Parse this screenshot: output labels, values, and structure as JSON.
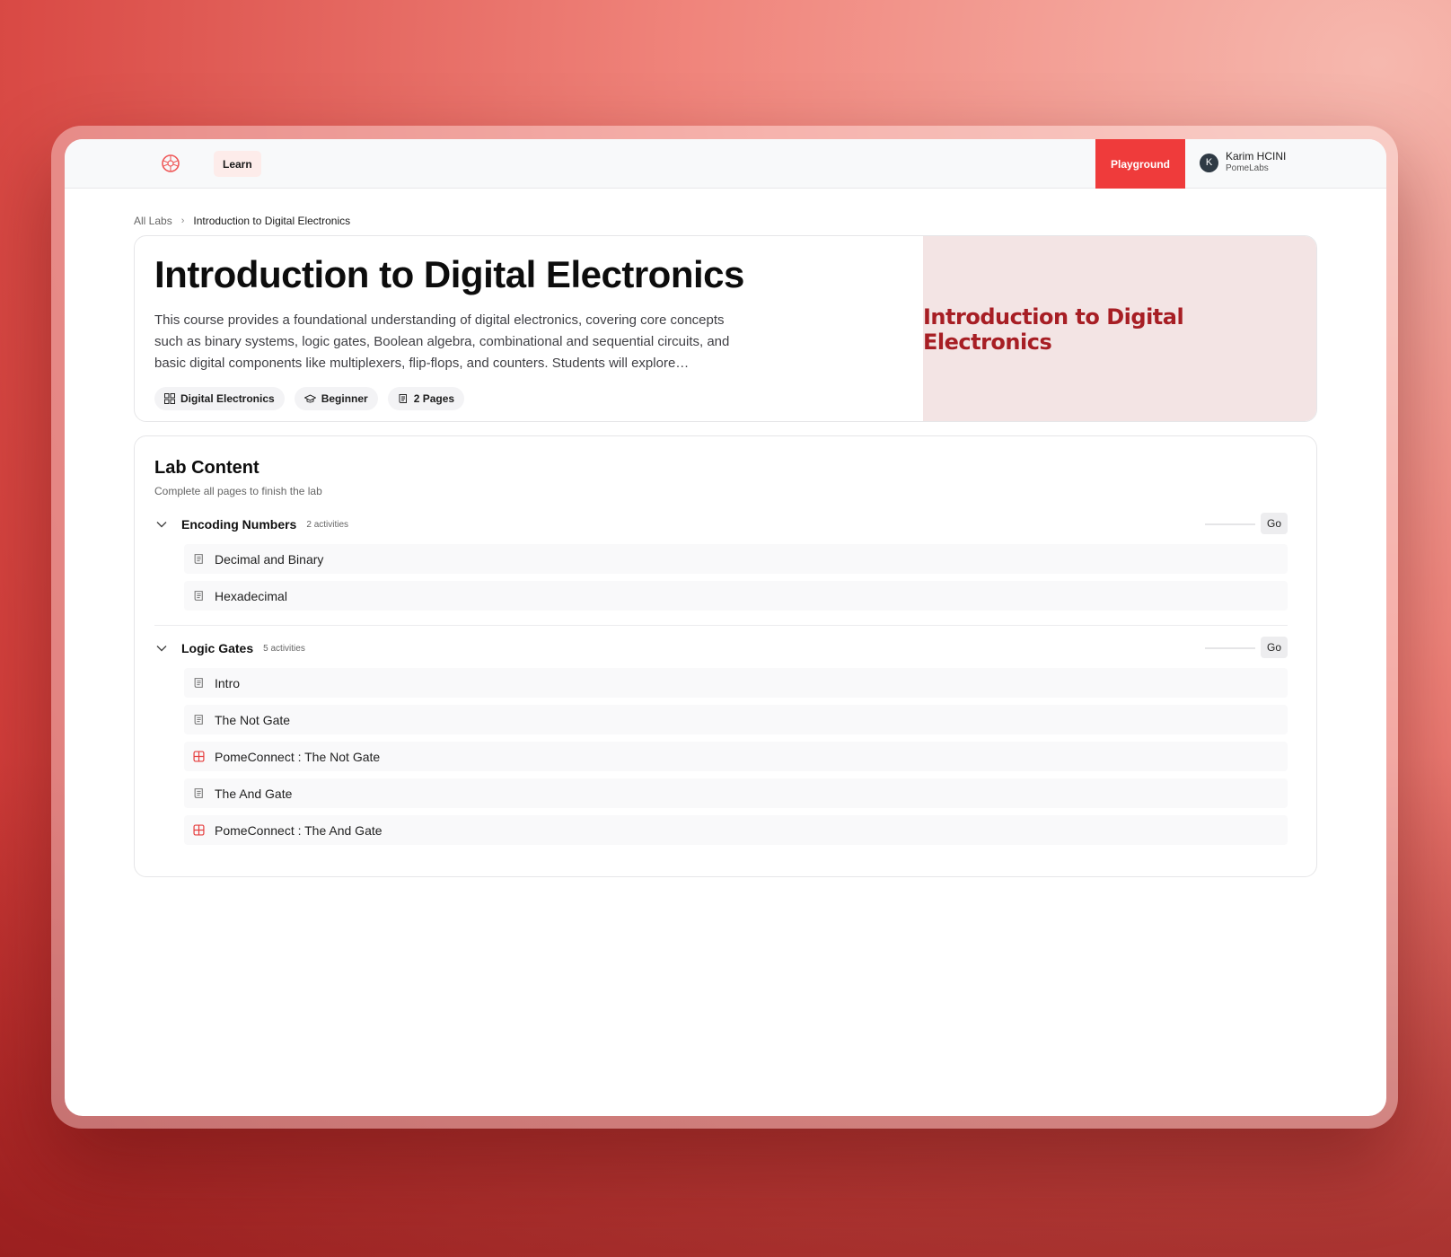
{
  "colors": {
    "accent": "#ef3b3b",
    "hero_panel_bg": "#f3e4e4",
    "hero_panel_text": "#a71e24"
  },
  "nav": {
    "logo_icon": "pomelabs-logo-icon",
    "learn_label": "Learn",
    "playground_label": "Playground",
    "user": {
      "initial": "K",
      "name": "Karim HCINI",
      "org": "PomeLabs"
    }
  },
  "breadcrumb": {
    "root": "All Labs",
    "separator": "›",
    "current": "Introduction to Digital Electronics"
  },
  "hero": {
    "title": "Introduction to Digital Electronics",
    "description": "This course provides a foundational understanding of digital electronics, covering core concepts such as binary systems, logic gates, Boolean algebra, combinational and sequential circuits, and basic digital components like multiplexers, flip-flops, and counters. Students will explore…",
    "tags": [
      {
        "icon": "grid-icon",
        "label": "Digital Electronics"
      },
      {
        "icon": "graduation-cap-icon",
        "label": "Beginner"
      },
      {
        "icon": "scroll-icon",
        "label": "2 Pages"
      }
    ],
    "panel_title": "Introduction to Digital Electronics"
  },
  "lab_content": {
    "title": "Lab Content",
    "subtitle": "Complete all pages to finish the lab",
    "sections": [
      {
        "name": "Encoding Numbers",
        "count": "2 activities",
        "go_label": "Go",
        "activities": [
          {
            "icon": "scroll-icon",
            "label": "Decimal and Binary"
          },
          {
            "icon": "scroll-icon",
            "label": "Hexadecimal"
          }
        ]
      },
      {
        "name": "Logic Gates",
        "count": "5 activities",
        "go_label": "Go",
        "activities": [
          {
            "icon": "scroll-icon",
            "label": "Intro"
          },
          {
            "icon": "scroll-icon",
            "label": "The Not Gate"
          },
          {
            "icon": "circuit-grid-icon",
            "label": "PomeConnect : The Not Gate"
          },
          {
            "icon": "scroll-icon",
            "label": "The And Gate"
          },
          {
            "icon": "circuit-grid-icon",
            "label": "PomeConnect : The And Gate"
          }
        ]
      }
    ]
  }
}
